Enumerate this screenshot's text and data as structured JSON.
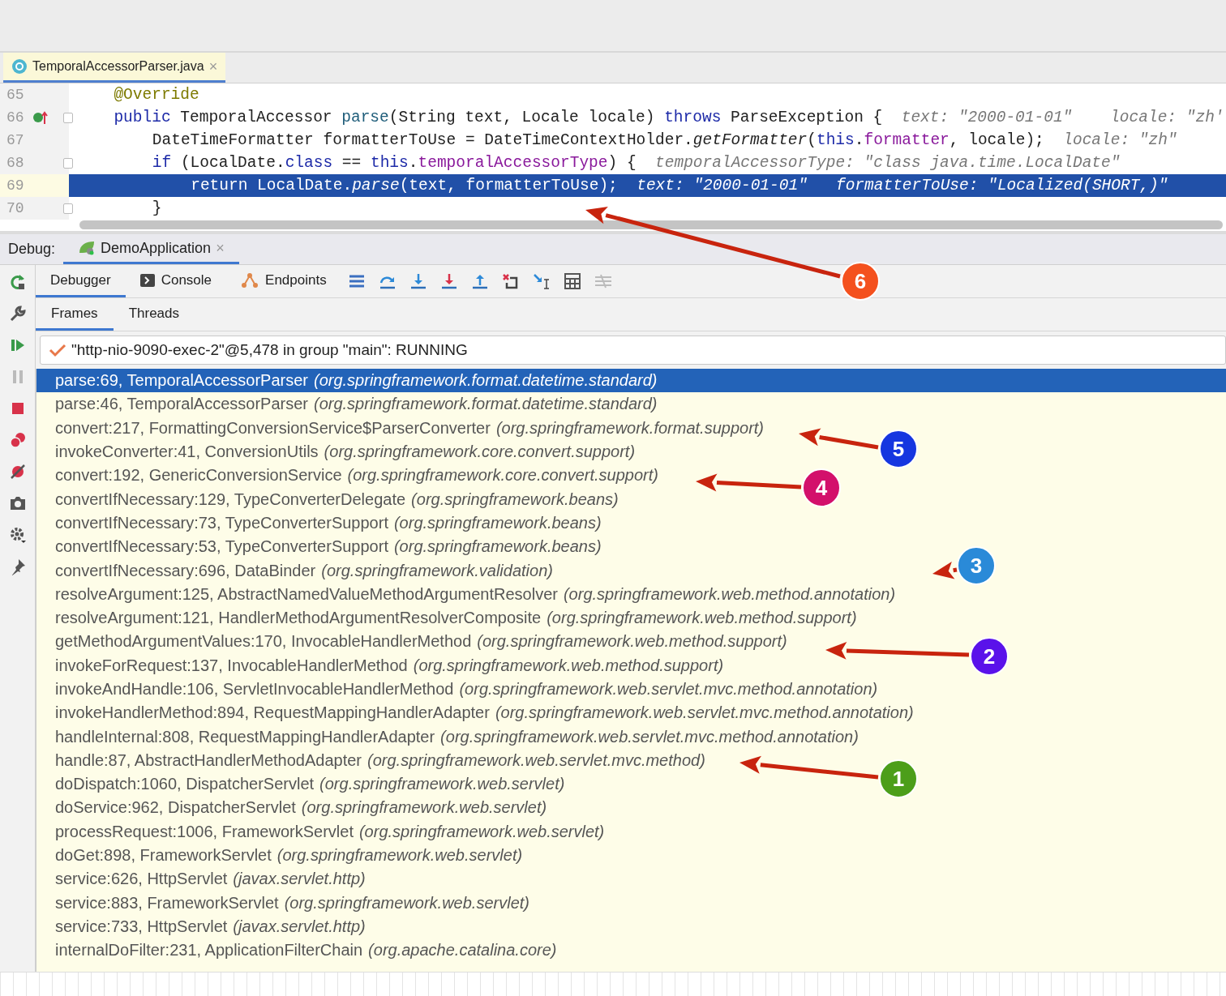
{
  "editor_tab": {
    "label": "TemporalAccessorParser.java",
    "close": "×"
  },
  "code_lines": [
    {
      "number": "65",
      "selected": false,
      "marker": false,
      "fold": false,
      "segments": [
        {
          "kind": "annotation",
          "text": "@Override"
        }
      ]
    },
    {
      "number": "66",
      "selected": false,
      "marker": true,
      "fold": true,
      "segments": [
        {
          "kind": "keyword",
          "text": "public"
        },
        {
          "kind": "plain",
          "text": " TemporalAccessor "
        },
        {
          "kind": "method",
          "text": "parse"
        },
        {
          "kind": "plain",
          "text": "(String text, Locale locale) "
        },
        {
          "kind": "keyword",
          "text": "throws"
        },
        {
          "kind": "plain",
          "text": " ParseException {  "
        },
        {
          "kind": "hint",
          "text": "text: \"2000-01-01\"    locale: \"zh'"
        }
      ]
    },
    {
      "number": "67",
      "selected": false,
      "marker": false,
      "fold": false,
      "segments": [
        {
          "kind": "plain",
          "text": "DateTimeFormatter formatterToUse = DateTimeContextHolder."
        },
        {
          "kind": "italic",
          "text": "getFormatter"
        },
        {
          "kind": "plain",
          "text": "("
        },
        {
          "kind": "keyword",
          "text": "this"
        },
        {
          "kind": "plain",
          "text": "."
        },
        {
          "kind": "field",
          "text": "formatter"
        },
        {
          "kind": "plain",
          "text": ", locale);  "
        },
        {
          "kind": "hint",
          "text": "locale: \"zh\""
        }
      ]
    },
    {
      "number": "68",
      "selected": false,
      "marker": false,
      "fold": true,
      "segments": [
        {
          "kind": "keyword",
          "text": "if"
        },
        {
          "kind": "plain",
          "text": " (LocalDate."
        },
        {
          "kind": "keyword",
          "text": "class"
        },
        {
          "kind": "plain",
          "text": " == "
        },
        {
          "kind": "keyword",
          "text": "this"
        },
        {
          "kind": "plain",
          "text": "."
        },
        {
          "kind": "field",
          "text": "temporalAccessorType"
        },
        {
          "kind": "plain",
          "text": ") {  "
        },
        {
          "kind": "hint",
          "text": "temporalAccessorType: \"class java.time.LocalDate\""
        }
      ]
    },
    {
      "number": "69",
      "selected": true,
      "marker": false,
      "fold": false,
      "segments": [
        {
          "kind": "plain",
          "text": "return LocalDate."
        },
        {
          "kind": "italic",
          "text": "parse"
        },
        {
          "kind": "plain",
          "text": "(text, formatterToUse);  "
        },
        {
          "kind": "hint",
          "text": "text: \"2000-01-01\"   formatterToUse: \"Localized(SHORT,)\""
        }
      ]
    },
    {
      "number": "70",
      "selected": false,
      "marker": false,
      "fold": true,
      "segments": [
        {
          "kind": "plain",
          "text": "}"
        }
      ]
    }
  ],
  "debug": {
    "label": "Debug:",
    "session": {
      "label": "DemoApplication",
      "close": "×"
    }
  },
  "toolbar_tabs": [
    {
      "label": "Debugger",
      "selected": true
    },
    {
      "label": "Console",
      "selected": false
    },
    {
      "label": "Endpoints",
      "selected": false
    }
  ],
  "frame_tabs": [
    {
      "label": "Frames",
      "selected": true
    },
    {
      "label": "Threads",
      "selected": false
    }
  ],
  "thread": "\"http-nio-9090-exec-2\"@5,478 in group \"main\": RUNNING",
  "frames": [
    {
      "location": "parse:69, TemporalAccessorParser",
      "package": "(org.springframework.format.datetime.standard)",
      "selected": true
    },
    {
      "location": "parse:46, TemporalAccessorParser",
      "package": "(org.springframework.format.datetime.standard)",
      "selected": false
    },
    {
      "location": "convert:217, FormattingConversionService$ParserConverter",
      "package": "(org.springframework.format.support)",
      "selected": false
    },
    {
      "location": "invokeConverter:41, ConversionUtils",
      "package": "(org.springframework.core.convert.support)",
      "selected": false
    },
    {
      "location": "convert:192, GenericConversionService",
      "package": "(org.springframework.core.convert.support)",
      "selected": false
    },
    {
      "location": "convertIfNecessary:129, TypeConverterDelegate",
      "package": "(org.springframework.beans)",
      "selected": false
    },
    {
      "location": "convertIfNecessary:73, TypeConverterSupport",
      "package": "(org.springframework.beans)",
      "selected": false
    },
    {
      "location": "convertIfNecessary:53, TypeConverterSupport",
      "package": "(org.springframework.beans)",
      "selected": false
    },
    {
      "location": "convertIfNecessary:696, DataBinder",
      "package": "(org.springframework.validation)",
      "selected": false
    },
    {
      "location": "resolveArgument:125, AbstractNamedValueMethodArgumentResolver",
      "package": "(org.springframework.web.method.annotation)",
      "selected": false
    },
    {
      "location": "resolveArgument:121, HandlerMethodArgumentResolverComposite",
      "package": "(org.springframework.web.method.support)",
      "selected": false
    },
    {
      "location": "getMethodArgumentValues:170, InvocableHandlerMethod",
      "package": "(org.springframework.web.method.support)",
      "selected": false
    },
    {
      "location": "invokeForRequest:137, InvocableHandlerMethod",
      "package": "(org.springframework.web.method.support)",
      "selected": false
    },
    {
      "location": "invokeAndHandle:106, ServletInvocableHandlerMethod",
      "package": "(org.springframework.web.servlet.mvc.method.annotation)",
      "selected": false
    },
    {
      "location": "invokeHandlerMethod:894, RequestMappingHandlerAdapter",
      "package": "(org.springframework.web.servlet.mvc.method.annotation)",
      "selected": false
    },
    {
      "location": "handleInternal:808, RequestMappingHandlerAdapter",
      "package": "(org.springframework.web.servlet.mvc.method.annotation)",
      "selected": false
    },
    {
      "location": "handle:87, AbstractHandlerMethodAdapter",
      "package": "(org.springframework.web.servlet.mvc.method)",
      "selected": false
    },
    {
      "location": "doDispatch:1060, DispatcherServlet",
      "package": "(org.springframework.web.servlet)",
      "selected": false
    },
    {
      "location": "doService:962, DispatcherServlet",
      "package": "(org.springframework.web.servlet)",
      "selected": false
    },
    {
      "location": "processRequest:1006, FrameworkServlet",
      "package": "(org.springframework.web.servlet)",
      "selected": false
    },
    {
      "location": "doGet:898, FrameworkServlet",
      "package": "(org.springframework.web.servlet)",
      "selected": false
    },
    {
      "location": "service:626, HttpServlet",
      "package": "(javax.servlet.http)",
      "selected": false
    },
    {
      "location": "service:883, FrameworkServlet",
      "package": "(org.springframework.web.servlet)",
      "selected": false
    },
    {
      "location": "service:733, HttpServlet",
      "package": "(javax.servlet.http)",
      "selected": false
    },
    {
      "location": "internalDoFilter:231, ApplicationFilterChain",
      "package": "(org.apache.catalina.core)",
      "selected": false
    }
  ],
  "annotations": [
    {
      "label": "6",
      "color": "#f4511e"
    },
    {
      "label": "5",
      "color": "#1636e0"
    },
    {
      "label": "4",
      "color": "#d3106b"
    },
    {
      "label": "3",
      "color": "#2a8ad8"
    },
    {
      "label": "2",
      "color": "#5a12ea"
    },
    {
      "label": "1",
      "color": "#4c9e1a"
    }
  ]
}
